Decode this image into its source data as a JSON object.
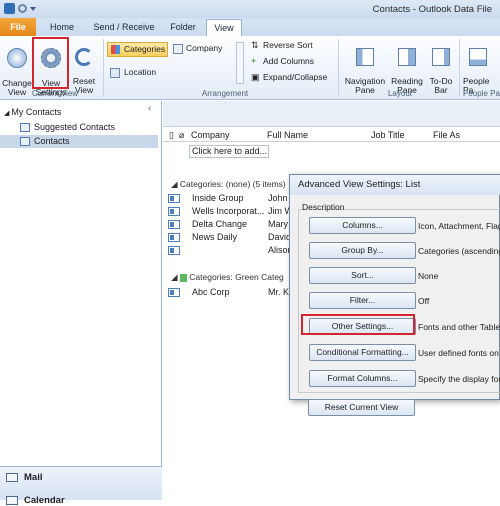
{
  "window": {
    "title": "Contacts - Outlook Data File"
  },
  "tabs": [
    "File",
    "Home",
    "Send / Receive",
    "Folder",
    "View"
  ],
  "ribbon": {
    "change_view": "Change\nView",
    "view_settings": "View\nSettings",
    "reset_view": "Reset\nView",
    "group_current_view": "Current View",
    "categories": "Categories",
    "company": "Company",
    "location": "Location",
    "reverse_sort": "Reverse Sort",
    "add_columns": "Add Columns",
    "expand_collapse": "Expand/Collapse",
    "group_arrangement": "Arrangement",
    "navigation_pane": "Navigation\nPane",
    "reading_pane": "Reading\nPane",
    "todo_bar": "To-Do\nBar",
    "people_pane": "People\nPa",
    "group_layout": "Layout",
    "group_people": "People Pa"
  },
  "navpane": {
    "heading": "My Contacts",
    "items": [
      "Suggested Contacts",
      "Contacts"
    ],
    "bottom": [
      "Mail",
      "Calendar"
    ]
  },
  "list": {
    "columns": [
      "Company",
      "Full Name",
      "Job Title",
      "File As"
    ],
    "new_row": "Click here to add...",
    "group1": "Categories: (none) (5 items)",
    "rows": [
      {
        "company": "Inside Group",
        "name": "John"
      },
      {
        "company": "Wells Incorporat...",
        "name": "Jim W"
      },
      {
        "company": "Delta Change",
        "name": "Mary"
      },
      {
        "company": "News Daily",
        "name": "David"
      },
      {
        "company": "",
        "name": "Alison"
      }
    ],
    "group2": "Categories: Green Categ",
    "rows2": [
      {
        "company": "Abc Corp",
        "name": "Mr. Ka"
      }
    ]
  },
  "dialog": {
    "title": "Advanced View Settings: List",
    "description": "Description",
    "buttons": [
      {
        "label": "Columns...",
        "value": "Icon, Attachment, Flag"
      },
      {
        "label": "Group By...",
        "value": "Categories (ascending)"
      },
      {
        "label": "Sort...",
        "value": "None"
      },
      {
        "label": "Filter...",
        "value": "Off"
      },
      {
        "label": "Other Settings...",
        "value": "Fonts and other Table"
      },
      {
        "label": "Conditional Formatting...",
        "value": "User defined fonts on e"
      },
      {
        "label": "Format Columns...",
        "value": "Specify the display form"
      },
      {
        "label": "Reset Current View",
        "value": ""
      }
    ]
  },
  "colors": {
    "accent": "#d3262e",
    "file_tab": "#e4861a",
    "ribbon": "#e3ecf7"
  }
}
